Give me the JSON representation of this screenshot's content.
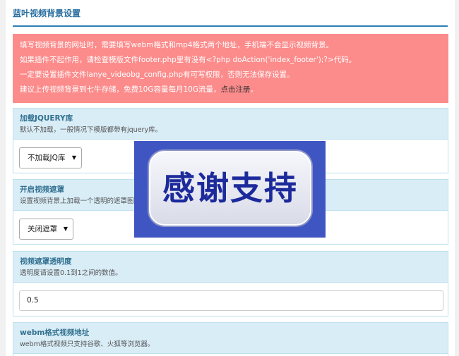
{
  "header": {
    "title": "蓝叶视频背景设置"
  },
  "notice": {
    "lines": [
      "填写视频背景的网址时，需要填写webm格式和mp4格式两个地址，手机端不会显示视频背景。",
      "如果插件不起作用，请检查模版文件footer.php里有没有<?php doAction('index_footer');?>代码。",
      "一定要设置插件文件lanye_videobg_config.php有可写权限，否则无法保存设置。"
    ],
    "last_line_prefix": "建议上传视频背景到七牛存储，免费10G容量每月10G流量，",
    "link_text": "点击注册",
    "last_line_suffix": "。"
  },
  "panels": {
    "jquery": {
      "title": "加载JQUERY库",
      "desc": "默认不加载，一般情况下模版都带有jquery库。",
      "selected": "不加载JQ库"
    },
    "mask": {
      "title": "开启视频遮罩",
      "desc": "设置视频背景上加载一个透明的遮罩图层",
      "selected": "关闭遮罩"
    },
    "opacity": {
      "title": "视频遮罩透明度",
      "desc": "透明度请设置0.1到1之间的数值。",
      "value": "0.5"
    },
    "webm": {
      "title": "webm格式视频地址",
      "desc": "webm格式视频只支持谷歌、火狐等浏览器。"
    }
  },
  "overlay": {
    "text": "感谢支持"
  },
  "icons": {
    "select_arrow": "triangle-down-icon"
  },
  "colors": {
    "accent": "#2d7fb4",
    "notice_bg": "#fc8b8b",
    "panel_head": "#d9edf7",
    "overlay_bg": "#3f56c2"
  }
}
